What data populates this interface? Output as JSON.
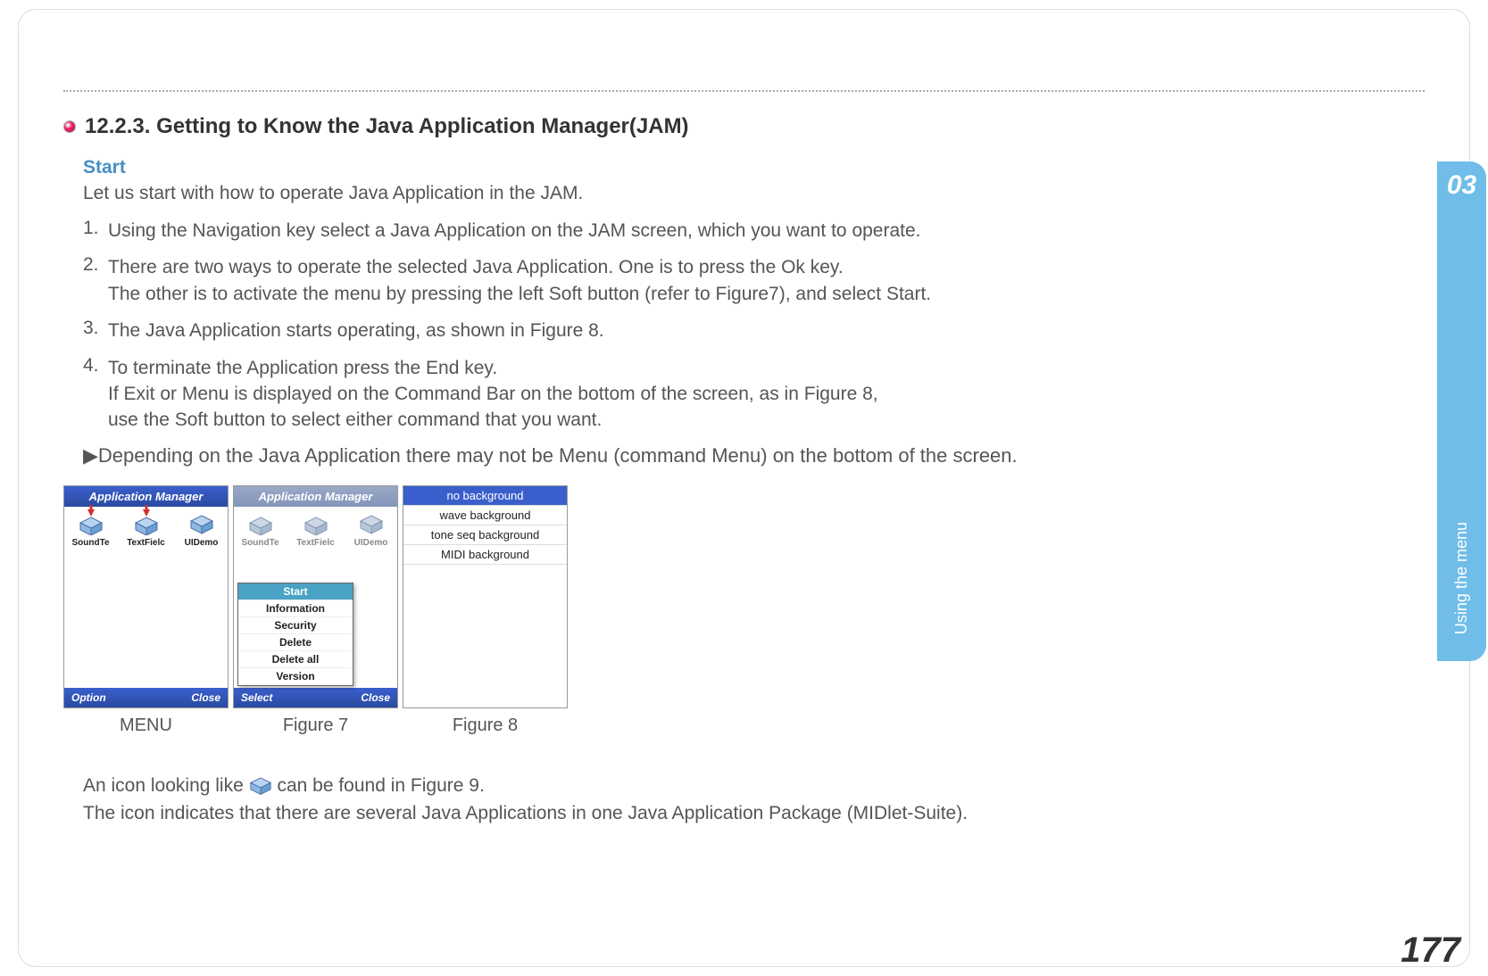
{
  "heading": "12.2.3. Getting to Know the Java Application Manager(JAM)",
  "sub_heading": "Start",
  "intro": "Let us start with how to operate Java Application in the JAM.",
  "steps": [
    {
      "num": "1.",
      "text": "Using the Navigation key select a Java Application on the JAM screen, which you want to operate."
    },
    {
      "num": "2.",
      "text": "There are two ways to operate the selected Java Application. One is to press the Ok key.\nThe other is to activate the menu by pressing the left Soft button (refer to Figure7), and select Start."
    },
    {
      "num": "3.",
      "text": "The Java Application starts operating, as shown in Figure 8."
    },
    {
      "num": "4.",
      "text": "To terminate the Application press the End key.\nIf Exit or Menu is displayed on the Command Bar on the bottom of the screen, as in Figure 8,\nuse the Soft button to select either command that you want."
    }
  ],
  "note": "▶Depending on the Java Application there may not be Menu (command Menu) on the bottom of the screen.",
  "figures": {
    "menu_screen": {
      "title": "Application Manager",
      "apps": [
        "SoundTe",
        "TextFielc",
        "UIDemo"
      ],
      "cmd_left": "Option",
      "cmd_right": "Close",
      "caption": "MENU"
    },
    "fig7": {
      "title": "Application Manager",
      "apps": [
        "SoundTe",
        "TextFielc",
        "UIDemo"
      ],
      "menu_items": [
        "Start",
        "Information",
        "Security",
        "Delete",
        "Delete all",
        "Version"
      ],
      "cmd_left": "Select",
      "cmd_right": "Close",
      "caption": "Figure 7"
    },
    "fig8": {
      "items": [
        "no background",
        "wave background",
        "tone seq background",
        "MIDI background"
      ],
      "caption": "Figure 8"
    }
  },
  "trailing": {
    "line1_a": "An icon looking like ",
    "line1_b": " can be found in Figure 9.",
    "line2": "The icon indicates that there are several Java Applications in one Java Application Package (MIDlet-Suite)."
  },
  "side_tab": {
    "num": "03",
    "label": "Using the menu"
  },
  "page_number": "177"
}
